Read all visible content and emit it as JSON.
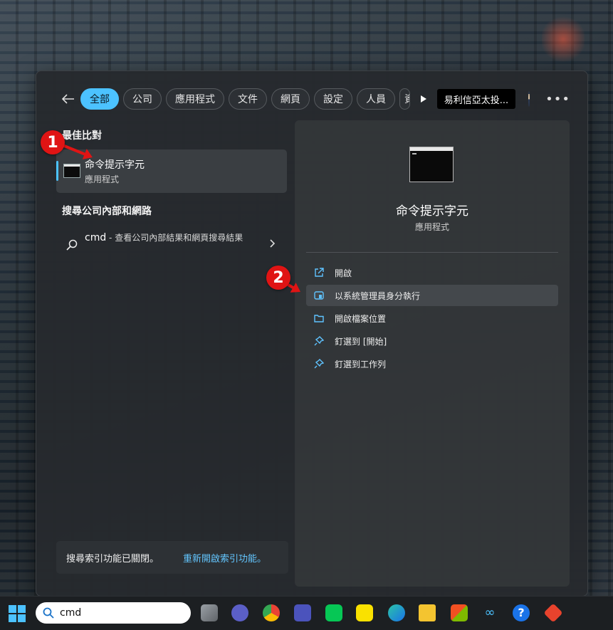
{
  "filters": {
    "chips": [
      "全部",
      "公司",
      "應用程式",
      "文件",
      "網頁",
      "設定",
      "人員",
      "資"
    ],
    "organization": "易利信亞太投..."
  },
  "best_match": {
    "section_title": "最佳比對",
    "name": "命令提示字元",
    "type": "應用程式"
  },
  "web_search": {
    "section_title": "搜尋公司內部和網路",
    "query": "cmd",
    "description": " - 查看公司內部結果和網頁搜尋結果"
  },
  "index_notice": {
    "text": "搜尋索引功能已關閉。",
    "link": "重新開啟索引功能。"
  },
  "detail": {
    "title": "命令提示字元",
    "subtitle": "應用程式",
    "actions": [
      {
        "label": "開啟",
        "icon": "open-external-icon"
      },
      {
        "label": "以系統管理員身分執行",
        "icon": "shield-icon"
      },
      {
        "label": "開啟檔案位置",
        "icon": "folder-icon"
      },
      {
        "label": "釘選到 [開始]",
        "icon": "pin-icon"
      },
      {
        "label": "釘選到工作列",
        "icon": "pin-icon"
      }
    ]
  },
  "markers": [
    "1",
    "2"
  ],
  "taskbar": {
    "search_value": "cmd",
    "apps": [
      "task-view",
      "teams-chat",
      "chrome",
      "teams",
      "line",
      "kakaotalk",
      "edge",
      "file-explorer",
      "microsoft-store",
      "meta",
      "help",
      "office"
    ]
  },
  "colors": {
    "accent": "#4cc2ff",
    "marker": "#e01414",
    "panel": "#262a2e"
  }
}
